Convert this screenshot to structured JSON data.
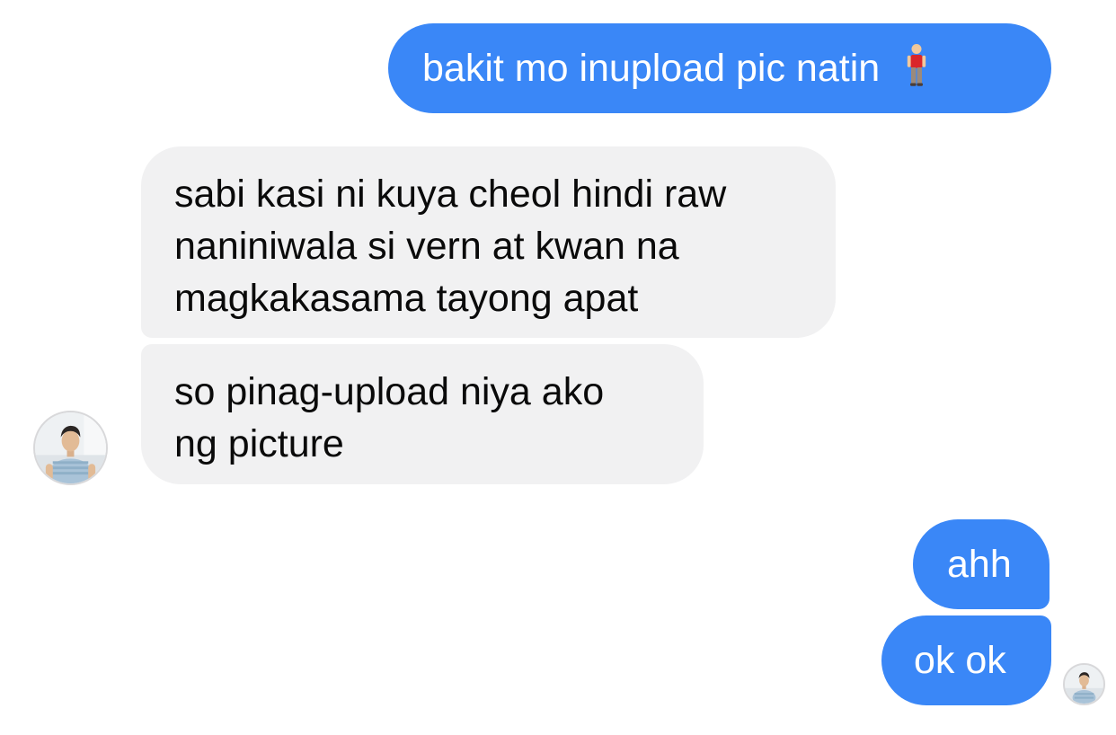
{
  "conversation": {
    "messages": [
      {
        "direction": "outgoing",
        "text": "bakit mo inupload pic natin",
        "emoji": "person-standing-emoji"
      },
      {
        "direction": "incoming",
        "lines": [
          "sabi kasi ni kuya cheol hindi raw",
          "naniniwala si vern at kwan na",
          "magkakasama tayong apat"
        ]
      },
      {
        "direction": "incoming",
        "lines": [
          "so pinag-upload niya ako",
          "ng picture"
        ]
      },
      {
        "direction": "outgoing",
        "text": "ahh"
      },
      {
        "direction": "outgoing",
        "text": "ok ok"
      }
    ]
  },
  "colors": {
    "outgoing_bubble": "#3a87f7",
    "incoming_bubble": "#f1f1f2",
    "outgoing_text": "#ffffff",
    "incoming_text": "#0a0a0a",
    "background": "#ffffff"
  },
  "avatars": {
    "contact": "profile-photo-avatar",
    "self": "read-receipt-avatar"
  }
}
